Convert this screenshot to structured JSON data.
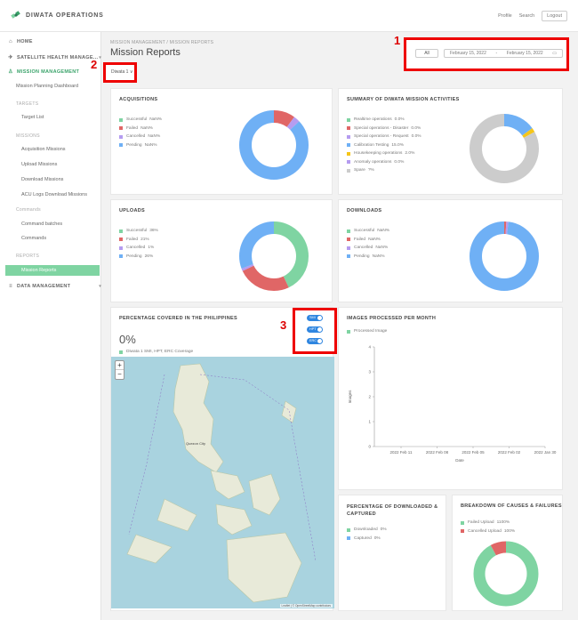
{
  "app": {
    "name": "DIWATA OPERATIONS"
  },
  "top_nav": {
    "profile": "Profile",
    "search": "Search",
    "logout": "Logout"
  },
  "sidebar": {
    "home": "HOME",
    "satellite_health": "SATELLITE HEALTH MANAGE...",
    "mission_management": "MISSION MANAGEMENT",
    "planning_dashboard": "Mission Planning Dashboard",
    "section_targets": "TARGETS",
    "target_list": "Target List",
    "section_missions": "MISSIONS",
    "acquisition_missions": "Acquisition Missions",
    "upload_missions": "Upload Missions",
    "download_missions": "Download Missions",
    "acu_logs": "ACU Logs Download Missions",
    "section_commands": "Commands",
    "command_batches": "Command batches",
    "commands": "Commands",
    "section_reports": "REPORTS",
    "mission_reports": "Mission Reports",
    "data_management": "DATA MANAGEMENT"
  },
  "breadcrumb": "MISSION MANAGEMENT  /  MISSION REPORTS",
  "page_title": "Mission Reports",
  "filter": {
    "all_label": "All",
    "date_from": "February 15, 2022",
    "date_sep": "-",
    "date_to": "February 15, 2022"
  },
  "satellite_select": {
    "value": "Diwata 1 ∨"
  },
  "annotations": {
    "one": "1",
    "two": "2",
    "three": "3"
  },
  "acquisitions": {
    "title": "ACQUISITIONS",
    "legend": [
      {
        "label": "Successful",
        "value": "NaN%",
        "color": "#7fd4a2"
      },
      {
        "label": "Failed",
        "value": "NaN%",
        "color": "#e06666"
      },
      {
        "label": "Cancelled",
        "value": "NaN%",
        "color": "#b59cf0"
      },
      {
        "label": "Pending",
        "value": "NaN%",
        "color": "#6fb0f5"
      }
    ]
  },
  "summary": {
    "title": "SUMMARY OF DIWATA MISSION ACTIVITIES",
    "legend": [
      {
        "label": "Realtime operations",
        "value": "0.0%",
        "color": "#7fd4a2"
      },
      {
        "label": "Special operations - Disaster",
        "value": "0.0%",
        "color": "#e06666"
      },
      {
        "label": "Special operations - Request",
        "value": "0.0%",
        "color": "#b59cf0"
      },
      {
        "label": "Calibration Testing",
        "value": "15.0%",
        "color": "#6fb0f5"
      },
      {
        "label": "Housekeeping operations",
        "value": "2.0%",
        "color": "#f5c518"
      },
      {
        "label": "Anomaly operations",
        "value": "0.0%",
        "color": "#b59cf0"
      },
      {
        "label": "Spare",
        "value": "?%",
        "color": "#cccccc"
      }
    ]
  },
  "uploads": {
    "title": "UPLOADS",
    "legend": [
      {
        "label": "Successful",
        "value": "36%",
        "color": "#7fd4a2"
      },
      {
        "label": "Failed",
        "value": "21%",
        "color": "#e06666"
      },
      {
        "label": "Cancelled",
        "value": "1%",
        "color": "#b59cf0"
      },
      {
        "label": "Pending",
        "value": "26%",
        "color": "#6fb0f5"
      }
    ]
  },
  "downloads": {
    "title": "DOWNLOADS",
    "legend": [
      {
        "label": "Successful",
        "value": "NaN%",
        "color": "#7fd4a2"
      },
      {
        "label": "Failed",
        "value": "NaN%",
        "color": "#e06666"
      },
      {
        "label": "Cancelled",
        "value": "NaN%",
        "color": "#b59cf0"
      },
      {
        "label": "Pending",
        "value": "NaN%",
        "color": "#6fb0f5"
      }
    ]
  },
  "coverage": {
    "title": "PERCENTAGE COVERED IN THE PHILIPPINES",
    "percent": "0%",
    "legend_label": "Diwata 1 SMI, HPT, ERC Coverage",
    "legend_color": "#7fd4a2",
    "toggles": [
      "SMI",
      "HPT",
      "ERC"
    ],
    "zoom_in": "+",
    "zoom_out": "−",
    "attribution": "Leaflet | © OpenStreetMap contributors",
    "city_label": "Quezon City"
  },
  "images_processed": {
    "title": "IMAGES PROCESSED PER MONTH",
    "legend_label": "Processed Image",
    "legend_color": "#7fd4a2"
  },
  "downloaded_captured": {
    "title": "PERCENTAGE OF DOWNLOADED & CAPTURED",
    "legend": [
      {
        "label": "Downloaded",
        "value": "0%",
        "color": "#7fd4a2"
      },
      {
        "label": "Captured",
        "value": "0%",
        "color": "#6fb0f5"
      }
    ]
  },
  "breakdown": {
    "title": "BREAKDOWN OF CAUSES & FAILURES",
    "legend": [
      {
        "label": "Failed Upload",
        "value": "1100%",
        "color": "#7fd4a2"
      },
      {
        "label": "Cancelled Upload",
        "value": "100%",
        "color": "#e06666"
      }
    ]
  },
  "chart_data": [
    {
      "type": "pie",
      "title": "ACQUISITIONS",
      "categories": [
        "Successful",
        "Failed",
        "Cancelled",
        "Pending"
      ],
      "values": [
        0,
        10,
        3,
        87
      ]
    },
    {
      "type": "pie",
      "title": "SUMMARY OF DIWATA MISSION ACTIVITIES",
      "categories": [
        "Calibration Testing",
        "Housekeeping operations",
        "Spare"
      ],
      "values": [
        15,
        2,
        83
      ]
    },
    {
      "type": "pie",
      "title": "UPLOADS",
      "categories": [
        "Successful",
        "Failed",
        "Cancelled",
        "Pending"
      ],
      "values": [
        36,
        21,
        1,
        26
      ]
    },
    {
      "type": "pie",
      "title": "DOWNLOADS",
      "categories": [
        "Successful",
        "Failed",
        "Cancelled",
        "Pending"
      ],
      "values": [
        0,
        1,
        1,
        98
      ]
    },
    {
      "type": "line",
      "title": "IMAGES PROCESSED PER MONTH",
      "xlabel": "Date",
      "ylabel": "Images",
      "x": [
        "2022 Feb 11",
        "2022 Feb 08",
        "2022 Feb 05",
        "2022 Feb 02",
        "2022 Jan 30"
      ],
      "yticks": [
        0,
        1,
        2,
        3,
        4
      ],
      "ylim": [
        0,
        4
      ],
      "series": [
        {
          "name": "Processed Image",
          "values": []
        }
      ]
    },
    {
      "type": "pie",
      "title": "BREAKDOWN OF CAUSES & FAILURES",
      "categories": [
        "Failed Upload",
        "Cancelled Upload"
      ],
      "values": [
        92,
        8
      ]
    }
  ]
}
